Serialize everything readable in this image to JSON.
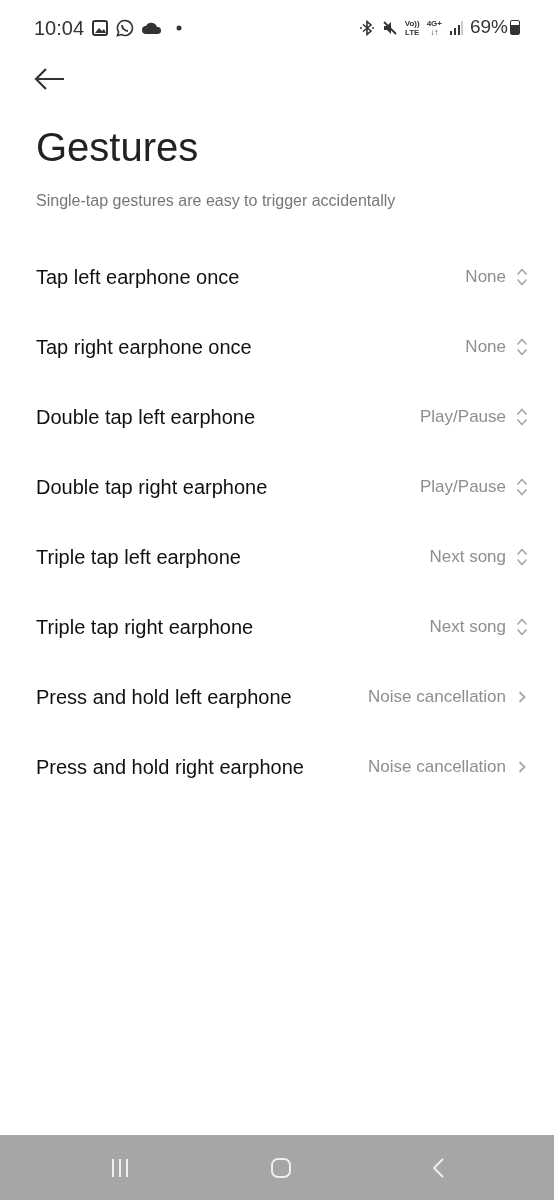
{
  "status_bar": {
    "time": "10:04",
    "network": [
      {
        "top": "Vo))",
        "bottom": "LTE"
      },
      {
        "top": "4G+",
        "bottom": "↓↑"
      }
    ],
    "battery": "69%"
  },
  "title": "Gestures",
  "subtitle": "Single-tap gestures are easy to trigger accidentally",
  "rows": [
    {
      "label": "Tap left earphone once",
      "value": "None",
      "kind": "dropdown"
    },
    {
      "label": "Tap right earphone once",
      "value": "None",
      "kind": "dropdown"
    },
    {
      "label": "Double tap left earphone",
      "value": "Play/Pause",
      "kind": "dropdown"
    },
    {
      "label": "Double tap right earphone",
      "value": "Play/Pause",
      "kind": "dropdown"
    },
    {
      "label": "Triple tap left earphone",
      "value": "Next song",
      "kind": "dropdown"
    },
    {
      "label": "Triple tap right earphone",
      "value": "Next song",
      "kind": "dropdown"
    },
    {
      "label": "Press and hold left earphone",
      "value": "Noise cancellation",
      "kind": "link"
    },
    {
      "label": "Press and hold right earphone",
      "value": "Noise cancellation",
      "kind": "link"
    }
  ]
}
